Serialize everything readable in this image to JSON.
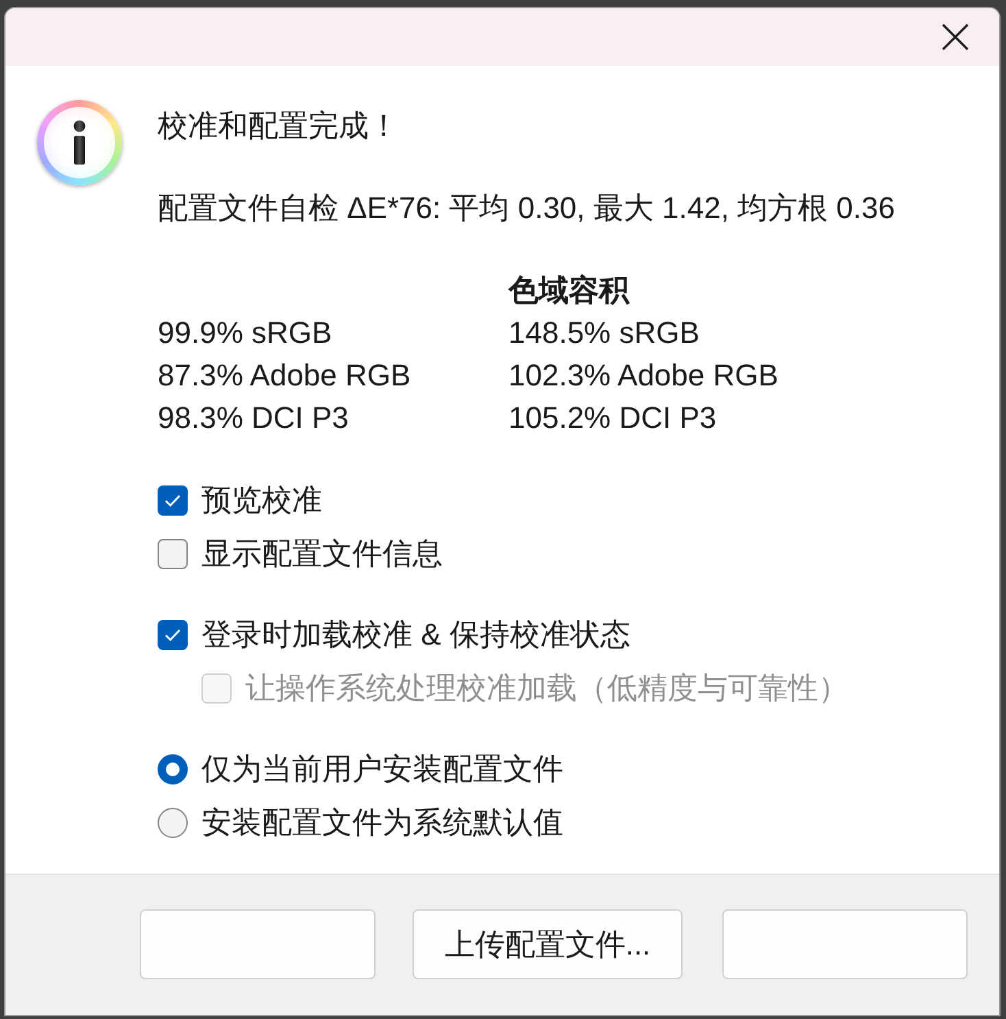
{
  "message": {
    "title": "校准和配置完成！",
    "self_check": "配置文件自检 ΔE*76: 平均 0.30, 最大 1.42, 均方根 0.36"
  },
  "gamut_table": {
    "header": {
      "column_2": "色域容积"
    },
    "rows": [
      [
        "99.9% sRGB",
        "148.5% sRGB"
      ],
      [
        "87.3% Adobe RGB",
        "102.3% Adobe RGB"
      ],
      [
        "98.3% DCI P3",
        "105.2% DCI P3"
      ]
    ]
  },
  "option_groups": [
    {
      "items": [
        {
          "label": "预览校准",
          "checked": true,
          "disabled": false
        },
        {
          "label": "显示配置文件信息",
          "checked": false,
          "disabled": false
        }
      ]
    },
    {
      "items": [
        {
          "label": "登录时加载校准 & 保持校准状态",
          "checked": true,
          "disabled": false,
          "children": [
            {
              "label": "让操作系统处理校准加载（低精度与可靠性）",
              "checked": false,
              "disabled": true
            }
          ]
        }
      ]
    }
  ],
  "install_options": [
    {
      "label": "仅为当前用户安装配置文件",
      "selected": true
    },
    {
      "label": "安装配置文件为系统默认值",
      "selected": false
    }
  ],
  "buttons": [
    {
      "kind": "blank"
    },
    {
      "kind": "text",
      "label": "上传配置文件..."
    },
    {
      "kind": "blank"
    }
  ]
}
